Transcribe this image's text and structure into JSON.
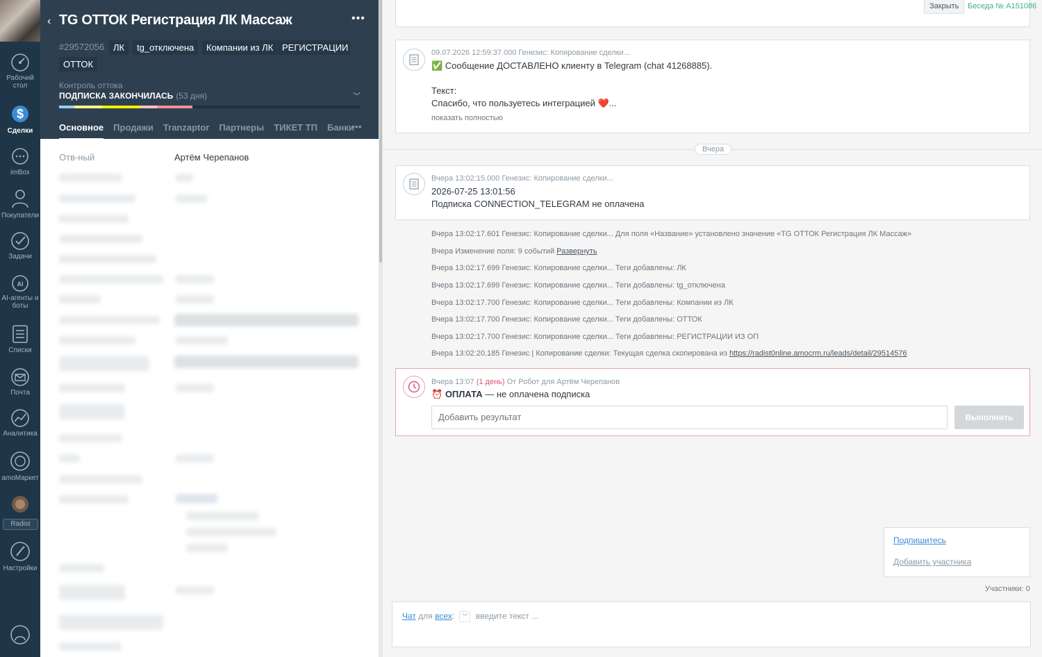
{
  "nav": {
    "items": [
      {
        "label": "Рабочий стол",
        "icon": "dashboard-icon"
      },
      {
        "label": "Сделки",
        "icon": "deals-icon",
        "active": true
      },
      {
        "label": "imBox",
        "icon": "chat-icon"
      },
      {
        "label": "Покупатели",
        "icon": "customers-icon"
      },
      {
        "label": "Задачи",
        "icon": "tasks-icon"
      },
      {
        "label": "AI-агенты и боты",
        "icon": "ai-agents-icon"
      },
      {
        "label": "Списки",
        "icon": "lists-icon"
      },
      {
        "label": "Почта",
        "icon": "mail-icon"
      },
      {
        "label": "Аналитика",
        "icon": "analytics-icon"
      },
      {
        "label": "amoМаркет",
        "icon": "market-icon"
      },
      {
        "label": "Radist",
        "icon": "radist-icon"
      },
      {
        "label": "Настройки",
        "icon": "settings-icon"
      }
    ]
  },
  "card": {
    "title": "TG ОТТОК Регистрация ЛК Массаж",
    "deal_id": "#29572056",
    "tags": [
      "ЛК",
      "tg_отключена",
      "Компании из ЛК",
      "РЕГИСТРАЦИИ И",
      "ОТТОК"
    ],
    "churn_label": "Контроль оттока",
    "churn_status": "ПОДПИСКА ЗАКОНЧИЛАСЬ",
    "churn_days": "(53 дня)",
    "pipeline_colors": [
      "#99ccfd",
      "#fffd7f",
      "#fff000",
      "#ff8f92",
      "#e53935"
    ],
    "tabs": [
      "Основное",
      "Продажи",
      "Tranzaptor",
      "Партнеры",
      "ТИКЕТ ТП",
      "Банки"
    ],
    "responsible_label": "Отв-ный",
    "responsible_value": "Артём Черепанов"
  },
  "feed": {
    "close_label": "Закрыть",
    "conversation_label": "Беседа № A151086",
    "msg1": {
      "meta": "09.07.2026 12:59:37.000 Генезис: Копирование сделки...",
      "line1": "✅ Сообщение ДОСТАВЛЕНО клиенту в Telegram (chat 41268885).",
      "line2": "Текст:",
      "line3": "Спасибо, что пользуетесь интеграцией ❤️...",
      "show_more": "показать полностью"
    },
    "day_label": "Вчера",
    "msg2": {
      "meta": "Вчера 13:02:15.000 Генезис: Копирование сделки...",
      "line1": "2026-07-25 13:01:56",
      "line2": "Подписка CONNECTION_TELEGRAM не оплачена"
    },
    "events": [
      "Вчера 13:02:17.601 Генезис: Копирование сделки... Для поля «Название» установлено значение «TG ОТТОК Регистрация ЛК Массаж»",
      "Вчера Изменение поля: 9 событий",
      "Вчера 13:02:17.699 Генезис: Копирование сделки... Теги добавлены: ЛК",
      "Вчера 13:02:17.699 Генезис: Копирование сделки... Теги добавлены: tg_отключена",
      "Вчера 13:02:17.700 Генезис: Копирование сделки... Теги добавлены: Компании из ЛК",
      "Вчера 13:02:17.700 Генезис: Копирование сделки... Теги добавлены: ОТТОК",
      "Вчера 13:02:17.700 Генезис: Копирование сделки... Теги добавлены: РЕГИСТРАЦИИ ИЗ ОП",
      "Вчера 13:02:20.185 Генезис | Копирование сделки: Текущая сделка скопирована из"
    ],
    "expand_link": "Развернуть",
    "source_link": "https://radist0nline.amocrm.ru/leads/detail/29514576",
    "task": {
      "meta_time": "Вчера 13:07",
      "meta_overdue": "(1 день)",
      "meta_from": "От Робот для Артём Черепанов",
      "title": "ОПЛАТА",
      "desc": " — не оплачена подписка",
      "input_placeholder": "Добавить результат",
      "exec_label": "Выполнить"
    },
    "subscribe_link": "Подпишитесь",
    "add_participant_link": "Добавить участника",
    "participants_count": "Участники: 0",
    "chat": {
      "chat_word": "Чат",
      "for_word": "для",
      "all_word": "всех",
      "placeholder": "введите текст ..."
    }
  }
}
